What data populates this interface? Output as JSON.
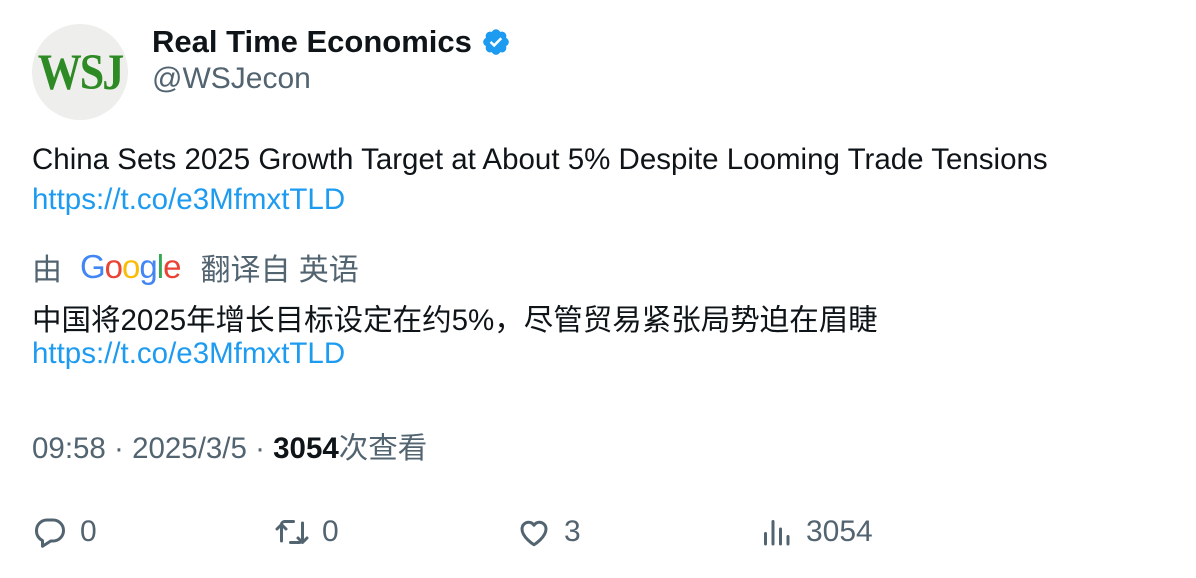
{
  "account": {
    "avatar_text": "WSJ",
    "display_name": "Real Time Economics",
    "handle": "@WSJecon",
    "verified": true
  },
  "tweet": {
    "text": "China Sets 2025 Growth Target at About 5% Despite Looming Trade Tensions",
    "link": "https://t.co/e3MfmxtTLD"
  },
  "translation": {
    "prefix": "由",
    "provider": "Google",
    "suffix": "翻译自 英语",
    "text": "中国将2025年增长目标设定在约5%，尽管贸易紧张局势迫在眉睫",
    "link": "https://t.co/e3MfmxtTLD"
  },
  "meta": {
    "time": "09:58",
    "sep1": "·",
    "date": "2025/3/5",
    "sep2": "·",
    "views_count": "3054",
    "views_label": "次查看"
  },
  "actions": {
    "replies": "0",
    "retweets": "0",
    "likes": "3",
    "views": "3054"
  },
  "colors": {
    "text": "#0f1419",
    "secondary": "#536471",
    "link": "#1d9bf0",
    "verified": "#1d9bf0",
    "avatar_bg": "#eeefec",
    "wsj_green": "#2e8a24"
  }
}
